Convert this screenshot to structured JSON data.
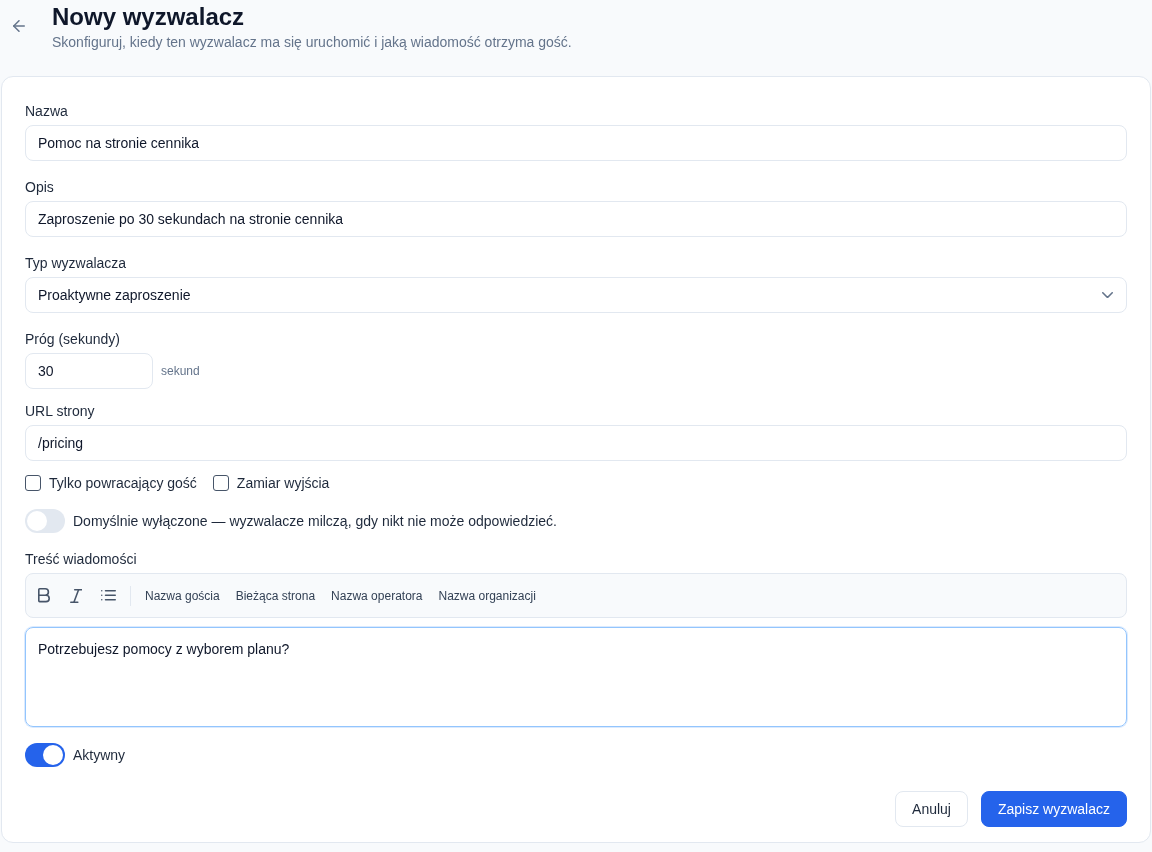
{
  "header": {
    "title": "Nowy wyzwalacz",
    "subtitle": "Skonfiguruj, kiedy ten wyzwalacz ma się uruchomić i jaką wiadomość otrzyma gość."
  },
  "form": {
    "fields": [
      {
        "kind": "text",
        "label": "Nazwa",
        "value": "Pomoc na stronie cennika"
      },
      {
        "kind": "text",
        "label": "Opis",
        "value": "Zaproszenie po 30 sekundach na stronie cennika"
      },
      {
        "kind": "select",
        "label": "Typ wyzwalacza",
        "value": "Proaktywne zaproszenie"
      },
      {
        "kind": "number",
        "label": "Próg (sekundy)",
        "value": "30",
        "unit": "sekund"
      },
      {
        "kind": "text",
        "label": "URL strony",
        "value": "/pricing"
      }
    ],
    "checkboxes": [
      {
        "label": "Tylko powracający gość",
        "checked": false
      },
      {
        "label": "Zamiar wyjścia",
        "checked": false
      }
    ],
    "quiet_toggle": {
      "label": "Domyślnie wyłączone — wyzwalacze milczą, gdy nikt nie może odpowiedzieć.",
      "on": false
    },
    "message": {
      "label": "Treść wiadomości",
      "format_buttons": [
        {
          "kind": "bold"
        },
        {
          "kind": "italic"
        },
        {
          "kind": "list"
        }
      ],
      "variables": [
        "Nazwa gościa",
        "Bieżąca strona",
        "Nazwa operatora",
        "Nazwa organizacji"
      ],
      "value": "Potrzebujesz pomocy z wyborem planu?",
      "focused": true
    },
    "active_toggle": {
      "label": "Aktywny",
      "on": true
    }
  },
  "buttons": [
    {
      "kind": "secondary",
      "label": "Anuluj"
    },
    {
      "kind": "primary",
      "label": "Zapisz wyzwalacz"
    }
  ]
}
